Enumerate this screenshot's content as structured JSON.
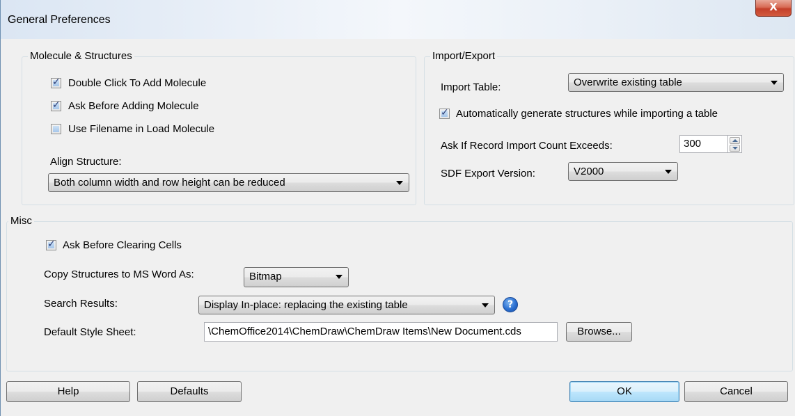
{
  "window": {
    "title": "General Preferences",
    "close_glyph": "X"
  },
  "molecule": {
    "legend": "Molecule & Structures",
    "checkboxes": [
      {
        "label": "Double Click To Add Molecule",
        "checked": true
      },
      {
        "label": "Ask Before Adding Molecule",
        "checked": true
      },
      {
        "label": "Use Filename in Load Molecule",
        "checked": false
      }
    ],
    "align_label": "Align Structure:",
    "align_value": "Both column width and row height can be reduced"
  },
  "import_export": {
    "legend": "Import/Export",
    "import_table_label": "Import Table:",
    "import_table_value": "Overwrite existing table",
    "auto_generate_label": "Automatically generate structures while importing a table",
    "auto_generate_checked": true,
    "record_count_label": "Ask If Record Import Count Exceeds:",
    "record_count_value": "300",
    "sdf_label": "SDF Export Version:",
    "sdf_value": "V2000"
  },
  "misc": {
    "legend": "Misc",
    "clear_cells_label": "Ask Before Clearing Cells",
    "clear_cells_checked": true,
    "copy_label": "Copy Structures to MS Word As:",
    "copy_value": "Bitmap",
    "search_label": "Search Results:",
    "search_value": "Display In-place: replacing the existing table",
    "help_glyph": "?",
    "style_sheet_label": "Default Style Sheet:",
    "style_sheet_value": "\\ChemOffice2014\\ChemDraw\\ChemDraw Items\\New Document.cds",
    "browse_label": "Browse..."
  },
  "buttons": {
    "help": "Help",
    "defaults": "Defaults",
    "ok": "OK",
    "cancel": "Cancel"
  },
  "icons": {
    "close": "close-icon",
    "help": "question-icon",
    "checkbox_check": "check-icon",
    "dropdown": "chevron-down-icon"
  }
}
